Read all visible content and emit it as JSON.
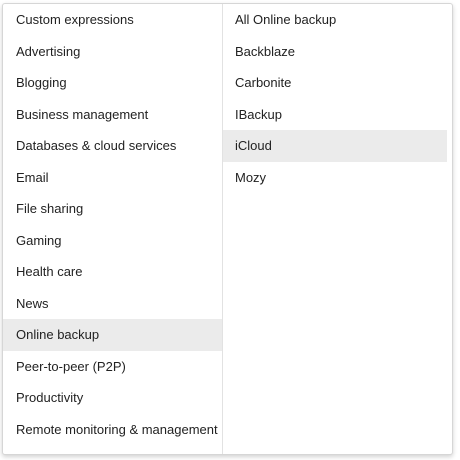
{
  "categories": {
    "items": [
      {
        "label": "Custom expressions",
        "active": false
      },
      {
        "label": "Advertising",
        "active": false
      },
      {
        "label": "Blogging",
        "active": false
      },
      {
        "label": "Business management",
        "active": false
      },
      {
        "label": "Databases & cloud services",
        "active": false
      },
      {
        "label": "Email",
        "active": false
      },
      {
        "label": "File sharing",
        "active": false
      },
      {
        "label": "Gaming",
        "active": false
      },
      {
        "label": "Health care",
        "active": false
      },
      {
        "label": "News",
        "active": false
      },
      {
        "label": "Online backup",
        "active": true
      },
      {
        "label": "Peer-to-peer (P2P)",
        "active": false
      },
      {
        "label": "Productivity",
        "active": false
      },
      {
        "label": "Remote monitoring & management",
        "active": false
      }
    ]
  },
  "subcategories": {
    "items": [
      {
        "label": "All Online backup",
        "active": false
      },
      {
        "label": "Backblaze",
        "active": false
      },
      {
        "label": "Carbonite",
        "active": false
      },
      {
        "label": "IBackup",
        "active": false
      },
      {
        "label": "iCloud",
        "active": true
      },
      {
        "label": "Mozy",
        "active": false
      }
    ]
  },
  "colors": {
    "highlight": "#ebebeb",
    "text": "#222222",
    "border": "#d6d6d6"
  }
}
